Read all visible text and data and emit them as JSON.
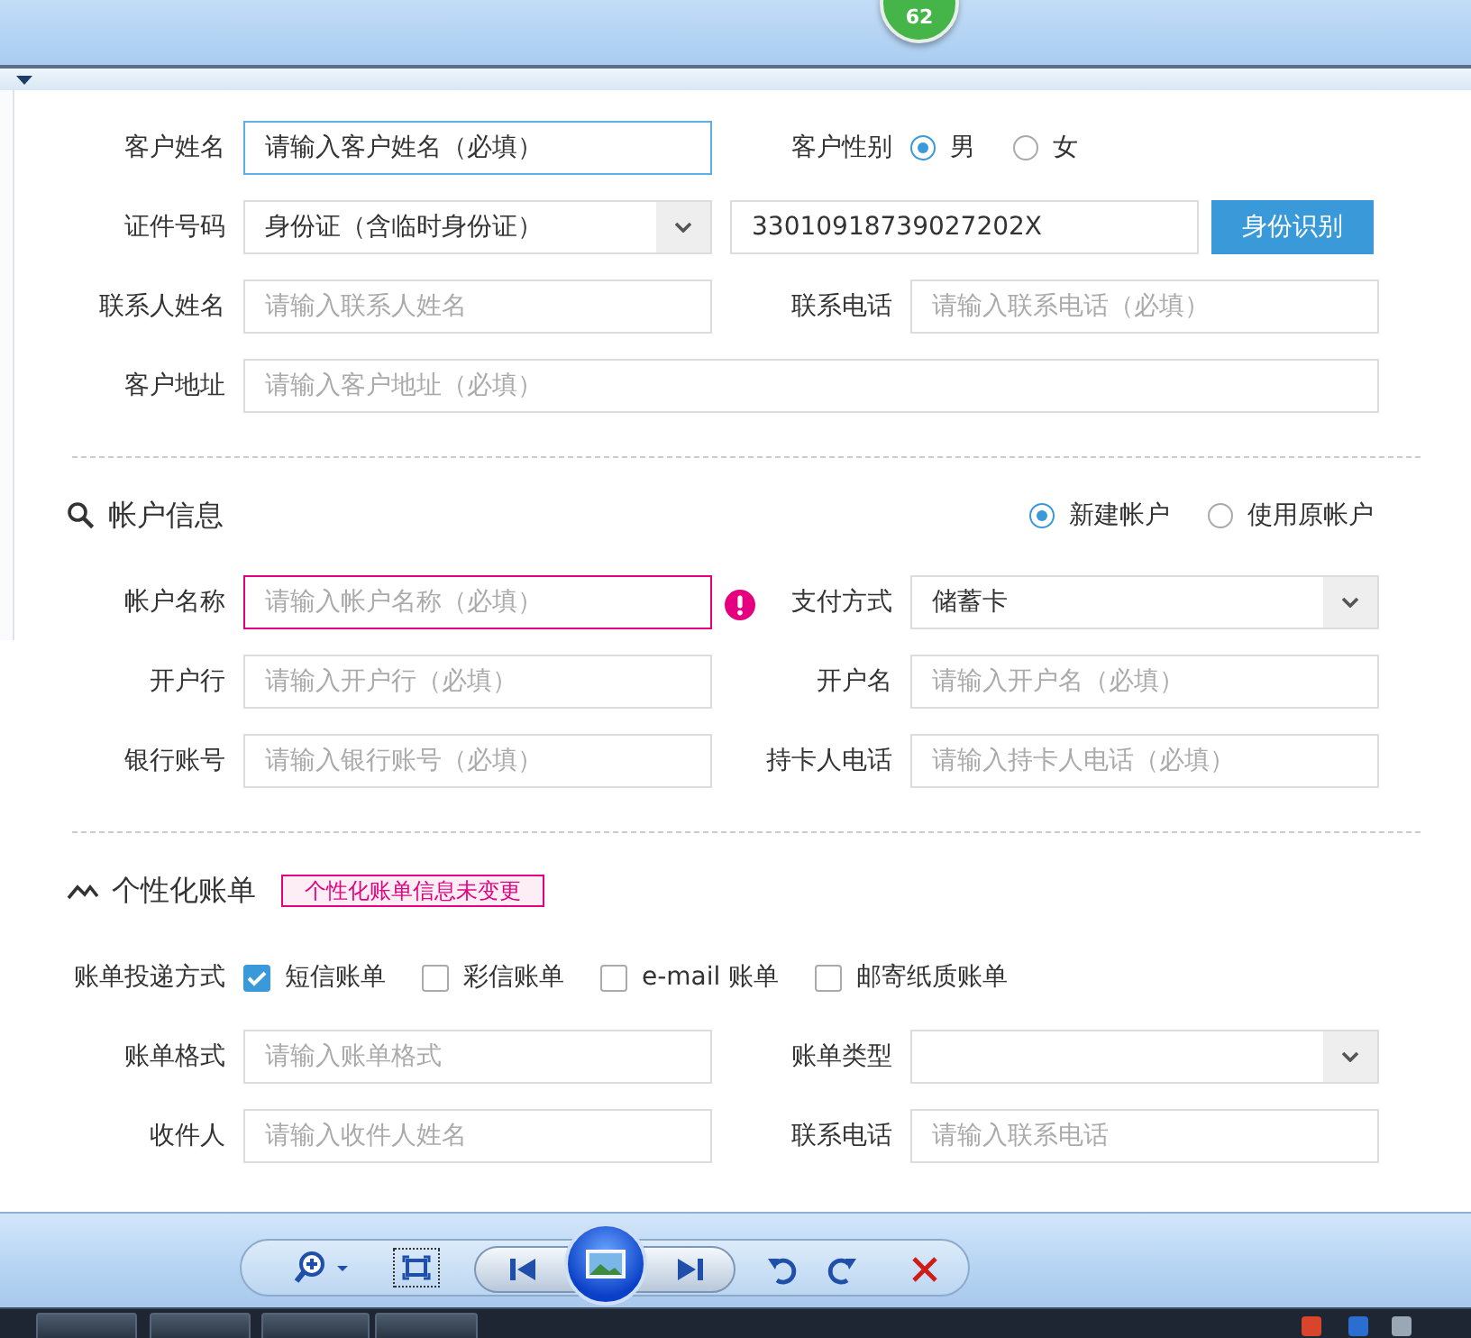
{
  "notification_badge": "62",
  "customer_rows": [
    [
      {
        "kind": "input",
        "label": "客户姓名",
        "value": "请输入客户姓名（必填）",
        "focused": true
      },
      {
        "kind": "radios",
        "label": "客户性别",
        "options": [
          {
            "label": "男",
            "selected": true
          },
          {
            "label": "女",
            "selected": false
          }
        ]
      }
    ],
    [
      {
        "kind": "id",
        "label": "证件号码",
        "select_value": "身份证（含临时身份证）",
        "value": "33010918739027202X",
        "button": "身份识别"
      }
    ],
    [
      {
        "kind": "input",
        "label": "联系人姓名",
        "placeholder": "请输入联系人姓名"
      },
      {
        "kind": "input",
        "label": "联系电话",
        "placeholder": "请输入联系电话（必填）"
      }
    ],
    [
      {
        "kind": "wide",
        "label": "客户地址",
        "placeholder": "请输入客户地址（必填）"
      }
    ]
  ],
  "account": {
    "title": "帐户信息",
    "modes": [
      {
        "label": "新建帐户",
        "selected": true
      },
      {
        "label": "使用原帐户",
        "selected": false
      }
    ],
    "rows": [
      [
        {
          "kind": "input",
          "label": "帐户名称",
          "placeholder": "请输入帐户名称（必填）",
          "invalid": true
        },
        {
          "kind": "select",
          "label": "支付方式",
          "value": "储蓄卡"
        }
      ],
      [
        {
          "kind": "input",
          "label": "开户行",
          "placeholder": "请输入开户行（必填）"
        },
        {
          "kind": "input",
          "label": "开户名",
          "placeholder": "请输入开户名（必填）"
        }
      ],
      [
        {
          "kind": "input",
          "label": "银行账号",
          "placeholder": "请输入银行账号（必填）"
        },
        {
          "kind": "input",
          "label": "持卡人电话",
          "placeholder": "请输入持卡人电话（必填）"
        }
      ]
    ]
  },
  "billing": {
    "title": "个性化账单",
    "notice": "个性化账单信息未变更",
    "delivery": {
      "label": "账单投递方式",
      "options": [
        {
          "label": "短信账单",
          "checked": true
        },
        {
          "label": "彩信账单",
          "checked": false
        },
        {
          "label": "e-mail 账单",
          "checked": false
        },
        {
          "label": "邮寄纸质账单",
          "checked": false
        }
      ]
    },
    "rows": [
      [
        {
          "kind": "input",
          "label": "账单格式",
          "placeholder": "请输入账单格式"
        },
        {
          "kind": "select",
          "label": "账单类型"
        }
      ],
      [
        {
          "kind": "input",
          "label": "收件人",
          "placeholder": "请输入收件人姓名"
        },
        {
          "kind": "input",
          "label": "联系电话",
          "placeholder": "请输入联系电话"
        }
      ]
    ]
  }
}
